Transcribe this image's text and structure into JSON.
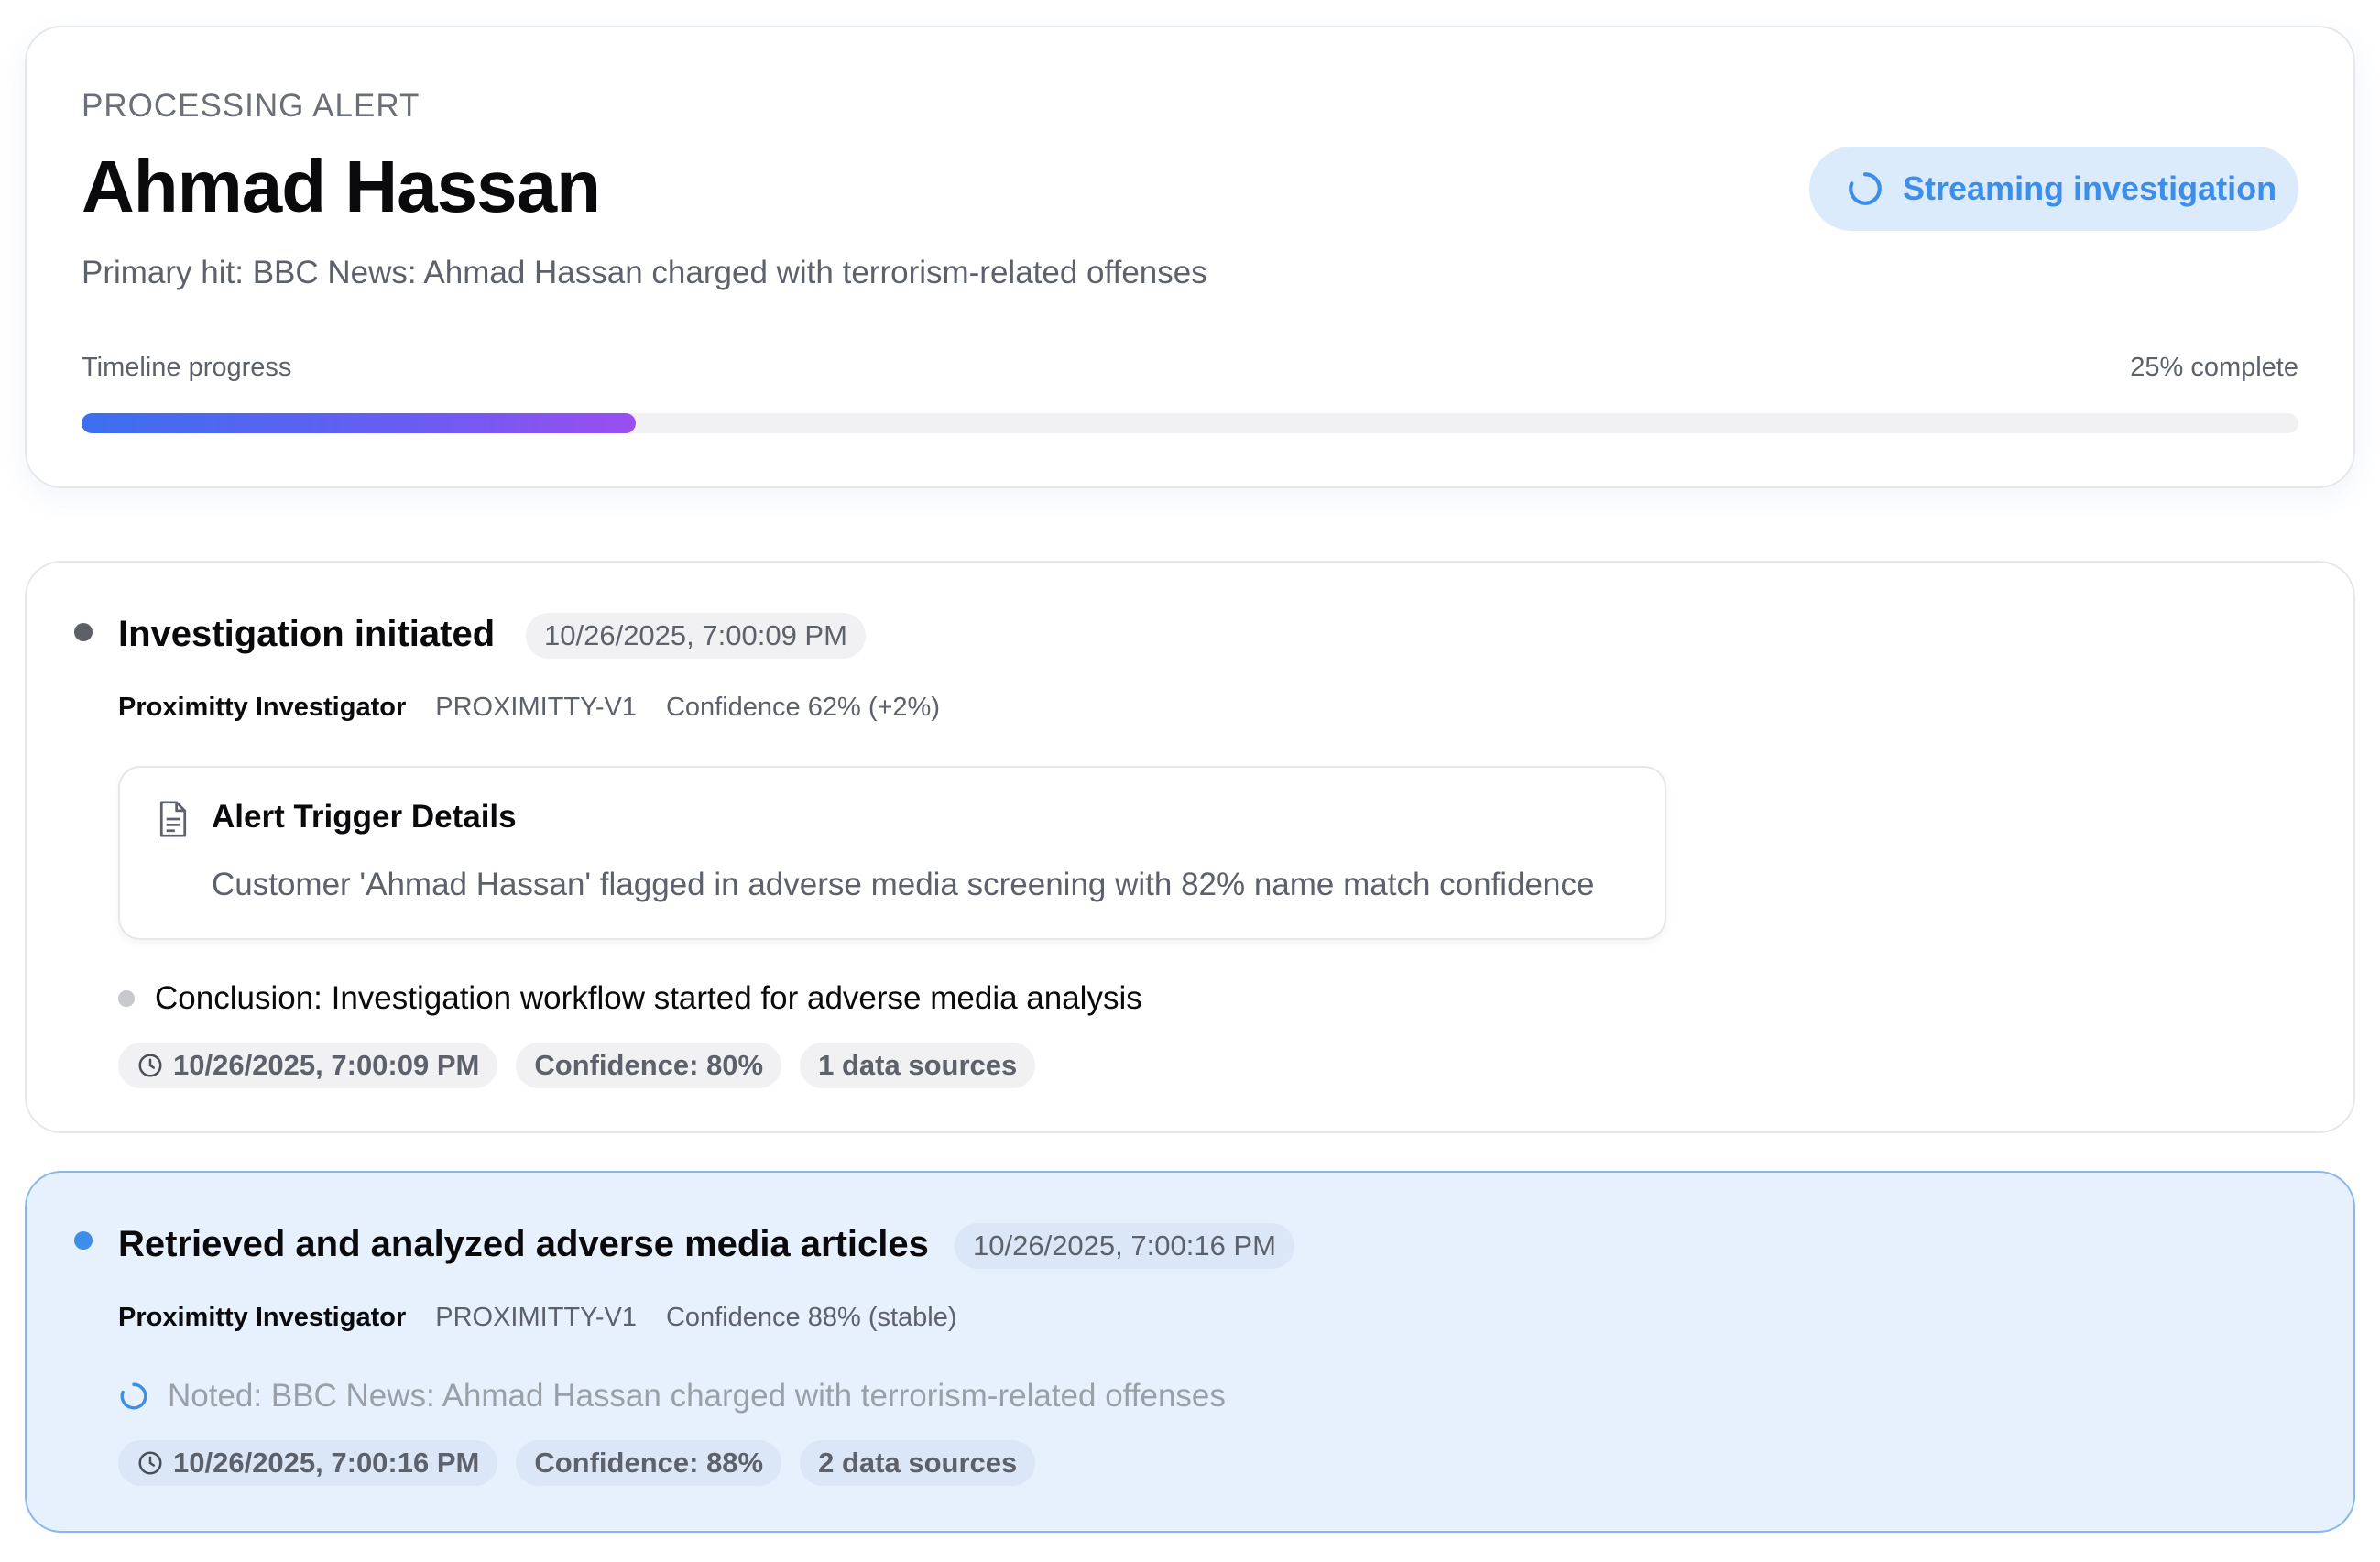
{
  "header": {
    "eyebrow": "PROCESSING ALERT",
    "subject_name": "Ahmad Hassan",
    "primary_hit": "Primary hit: BBC News: Ahmad Hassan charged with terrorism-related offenses",
    "status_pill": "Streaming investigation",
    "timeline_label": "Timeline progress",
    "timeline_percent_text": "25% complete",
    "progress_value": 0.25
  },
  "events": [
    {
      "title": "Investigation initiated",
      "timestamp": "10/26/2025, 7:00:09 PM",
      "agent": "Proximitty Investigator",
      "model": "PROXIMITTY-V1",
      "confidence_text": "Confidence 62% (+2%)",
      "dot_color": "#5e6068",
      "details": {
        "title": "Alert Trigger Details",
        "text": "Customer 'Ahmad Hassan' flagged in adverse media screening with 82% name match confidence"
      },
      "conclusion": "Conclusion: Investigation workflow started for adverse media analysis",
      "chips": {
        "time": "10/26/2025, 7:00:09 PM",
        "confidence": "Confidence: 80%",
        "sources": "1 data sources"
      }
    },
    {
      "title": "Retrieved and analyzed adverse media articles",
      "timestamp": "10/26/2025, 7:00:16 PM",
      "agent": "Proximitty Investigator",
      "model": "PROXIMITTY-V1",
      "confidence_text": "Confidence 88% (stable)",
      "dot_color": "#3d8ee8",
      "noted": "Noted: BBC News: Ahmad Hassan charged with terrorism-related offenses",
      "chips": {
        "time": "10/26/2025, 7:00:16 PM",
        "confidence": "Confidence: 88%",
        "sources": "2 data sources"
      }
    }
  ],
  "colors": {
    "accent": "#3d8ee8",
    "active_card_bg": "#e7f1fd",
    "active_card_border": "#8ab7ea"
  },
  "icons": {
    "status": "spinner-icon",
    "details": "document-icon",
    "time": "clock-icon",
    "pending": "spinner-icon"
  }
}
